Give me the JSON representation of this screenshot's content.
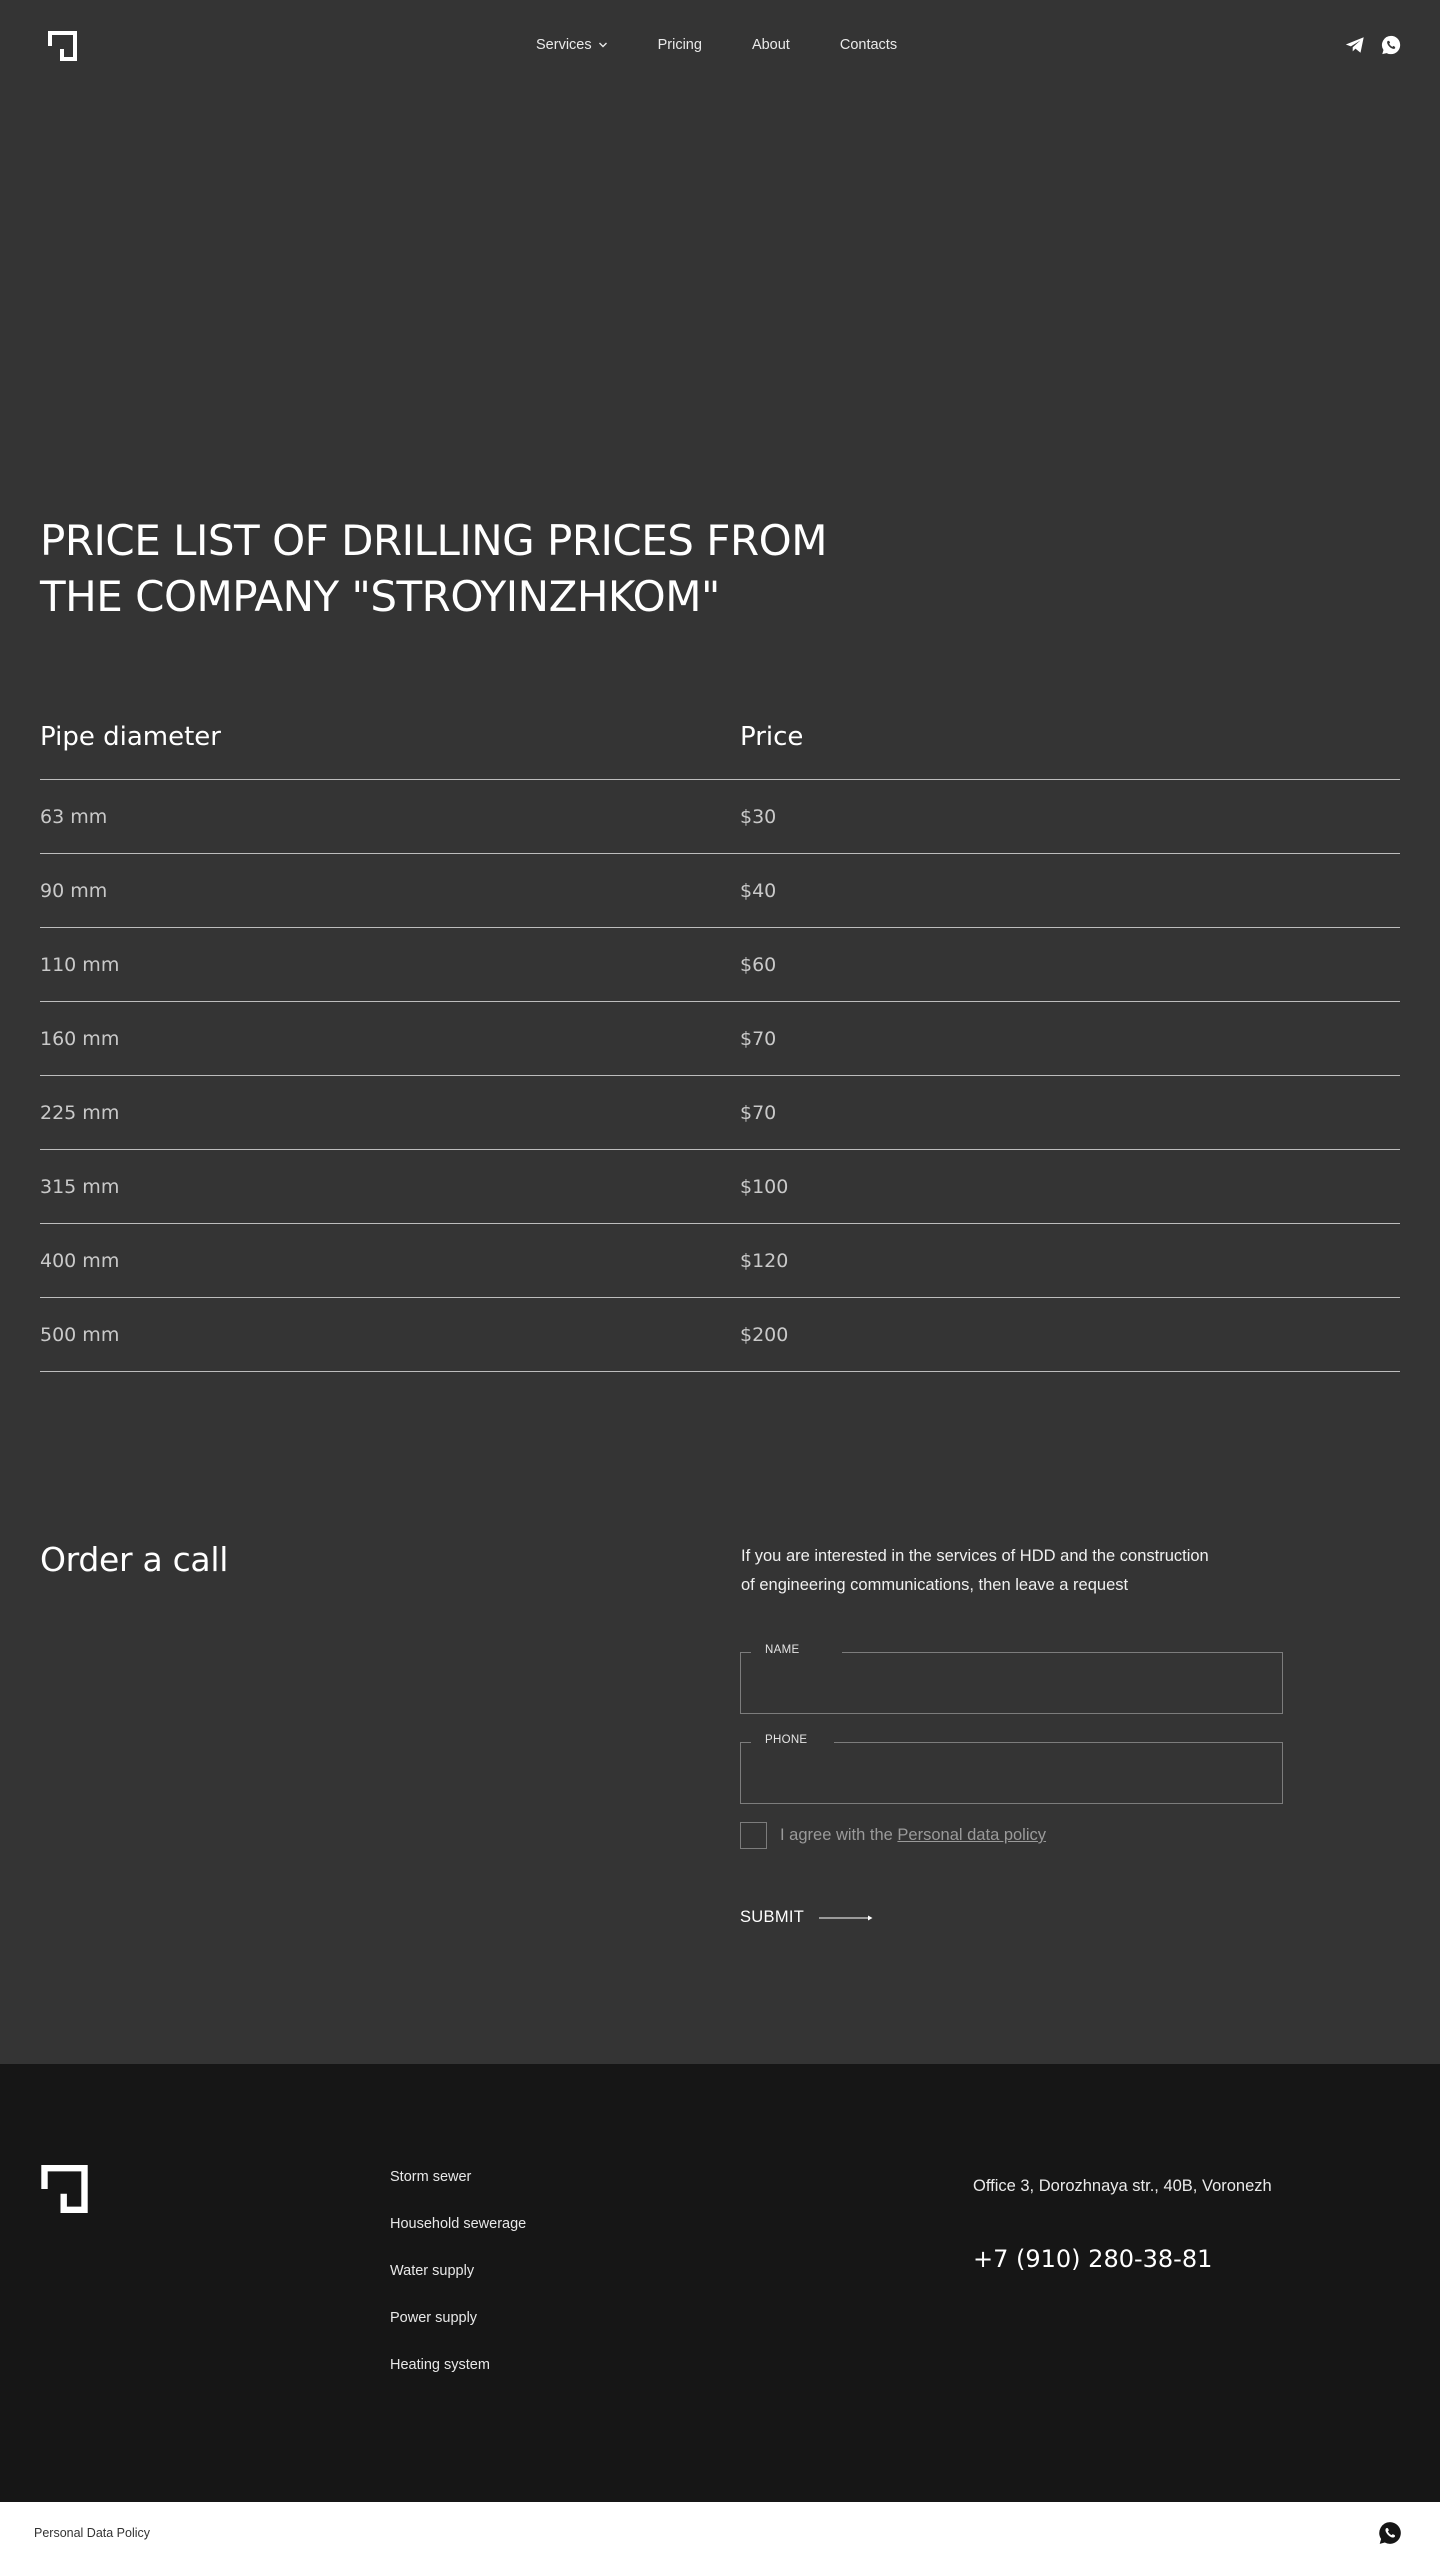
{
  "header": {
    "nav": {
      "services": "Services",
      "pricing": "Pricing",
      "about": "About",
      "contacts": "Contacts"
    },
    "icons": [
      "logo-icon",
      "chevron-down-icon",
      "telegram-icon",
      "whatsapp-icon"
    ]
  },
  "hero": {
    "title_line1": "PRICE LIST OF DRILLING PRICES FROM",
    "title_line2": "THE COMPANY \"STROYINZHKOM\""
  },
  "price_table": {
    "headers": {
      "diameter": "Pipe diameter",
      "price": "Price"
    },
    "rows": [
      {
        "diameter": "63 mm",
        "price": "$30"
      },
      {
        "diameter": "90 mm",
        "price": "$40"
      },
      {
        "diameter": "110 mm",
        "price": "$60"
      },
      {
        "diameter": "160 mm",
        "price": "$70"
      },
      {
        "diameter": "225 mm",
        "price": "$70"
      },
      {
        "diameter": "315 mm",
        "price": "$100"
      },
      {
        "diameter": "400 mm",
        "price": "$120"
      },
      {
        "diameter": "500 mm",
        "price": "$200"
      }
    ]
  },
  "order": {
    "title": "Order a call",
    "desc_line1": "If you are interested in the services of HDD and the construction",
    "desc_line2": "of engineering communications, then leave a request",
    "name_label": "NAME",
    "name_value": "",
    "phone_label": "PHONE",
    "phone_value": "",
    "agree_text": "I agree with the",
    "agree_link": "Personal data policy",
    "submit": "SUBMIT"
  },
  "footer": {
    "links": [
      "Storm sewer",
      "Household sewerage",
      "Water supply",
      "Power supply",
      "Heating system"
    ],
    "address": "Office 3, Dorozhnaya str., 40B, Voronezh",
    "phone": "+7 (910) 280-38-81"
  },
  "bottom_bar": {
    "policy": "Personal Data Policy"
  },
  "colors": {
    "page_bg": "#343434",
    "footer_bg": "#161616",
    "bottom_bg": "#ffffff",
    "text": "#ffffff",
    "muted": "#9a9a9a",
    "divider": "#bdbdbd"
  }
}
